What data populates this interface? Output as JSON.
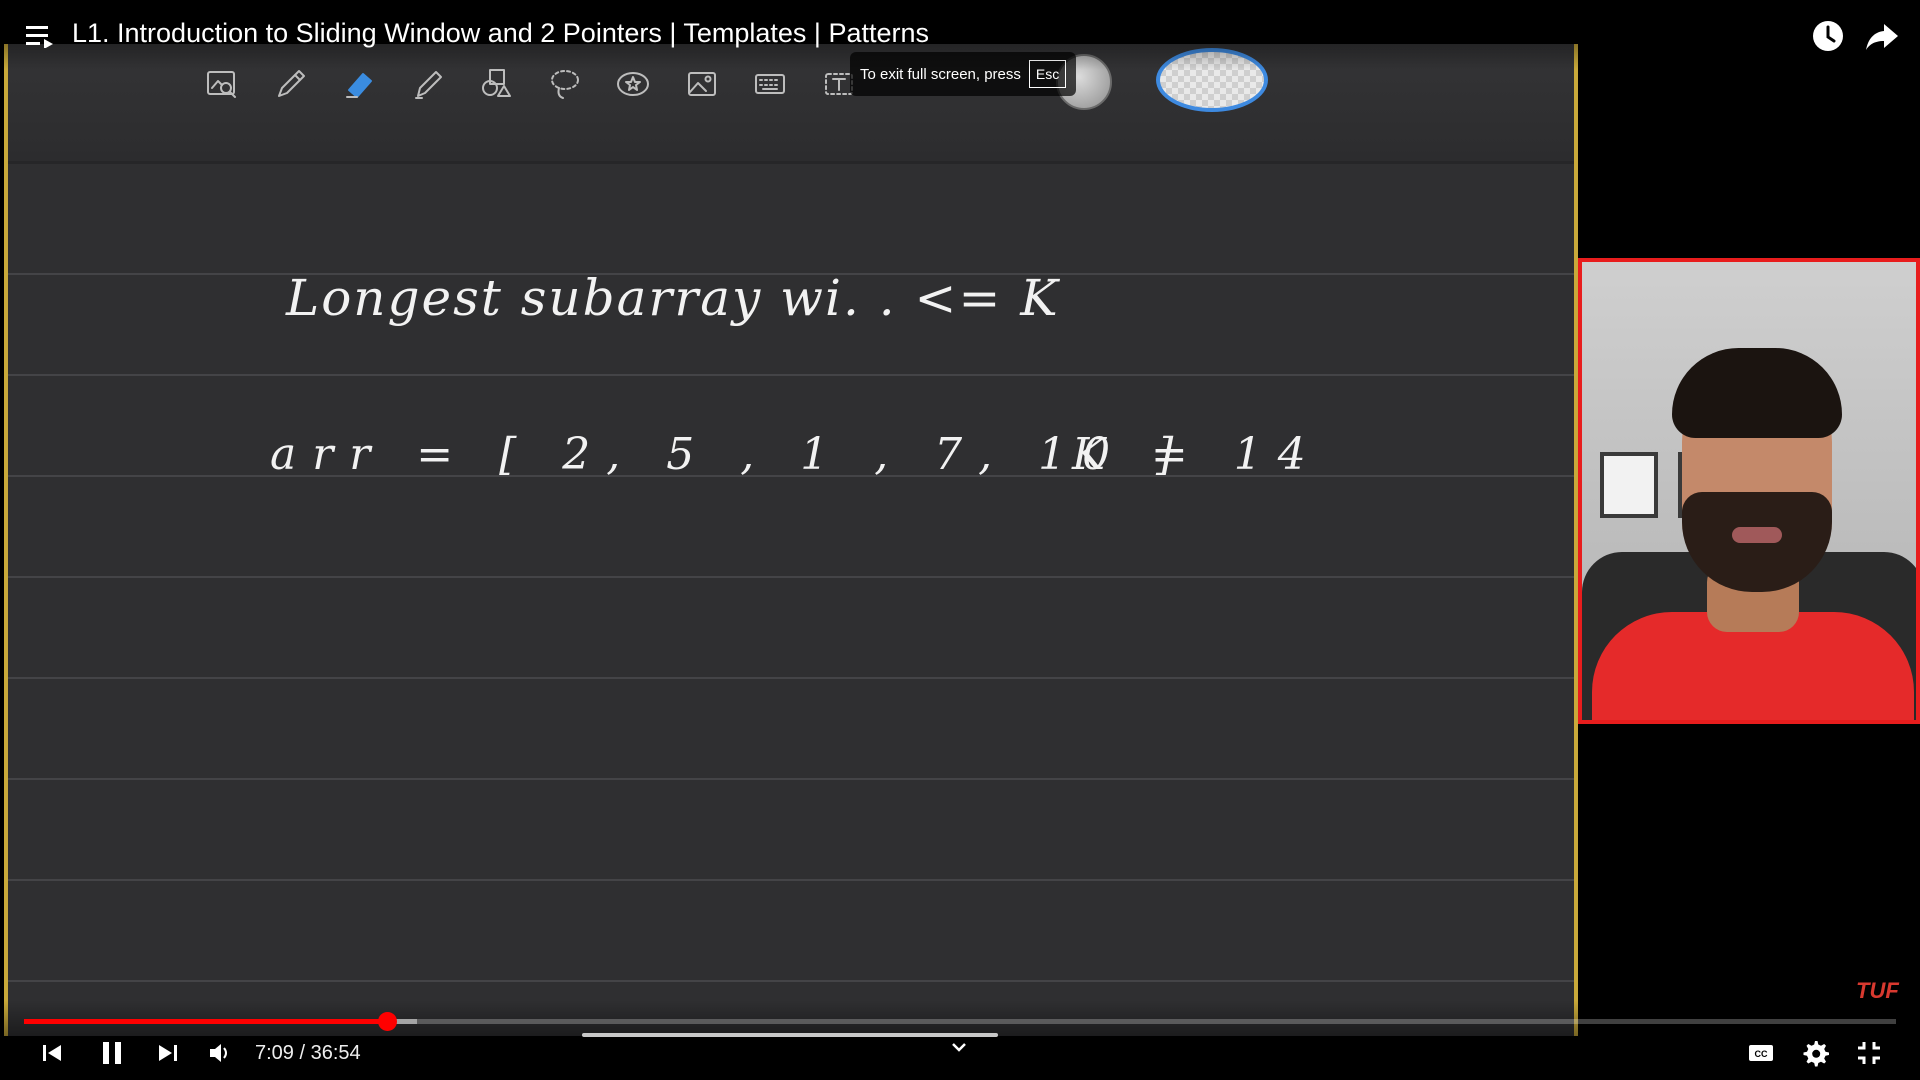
{
  "topbar": {
    "title": "L1. Introduction to Sliding Window and 2 Pointers | Templates | Patterns",
    "icons": [
      "playlist-menu-icon",
      "watch-later-clock-icon",
      "share-arrow-icon"
    ]
  },
  "board": {
    "tools": [
      "image-search-icon",
      "pen-icon",
      "eraser-icon",
      "highlighter-icon",
      "shapes-icon",
      "lasso-icon",
      "sticker-star-icon",
      "image-icon",
      "keyboard-icon",
      "text-box-icon"
    ],
    "active_tool": "eraser-icon",
    "exit_hint": {
      "text": "To exit full screen, press",
      "key": "Esc"
    },
    "handwriting": {
      "title": "Longest subarray wi.     . <= K",
      "array": "arr = [ 2, 5 , 1 , 7,  10 ]",
      "k": "K = 14"
    }
  },
  "watermark": "TUF",
  "player": {
    "current_time": "7:09",
    "duration": "36:54",
    "time_display": "7:09 / 36:54",
    "played_fraction": 0.194,
    "buffered_fraction": 0.21,
    "controls": [
      "previous-icon",
      "pause-icon",
      "next-icon",
      "volume-icon",
      "chevron-down-icon",
      "captions-icon",
      "settings-gear-icon",
      "exit-fullscreen-icon"
    ]
  },
  "colors": {
    "progress": "#ff0000",
    "board": "#2f2f31",
    "border": "#c9a93a",
    "webcam_border": "#e81d1d"
  }
}
